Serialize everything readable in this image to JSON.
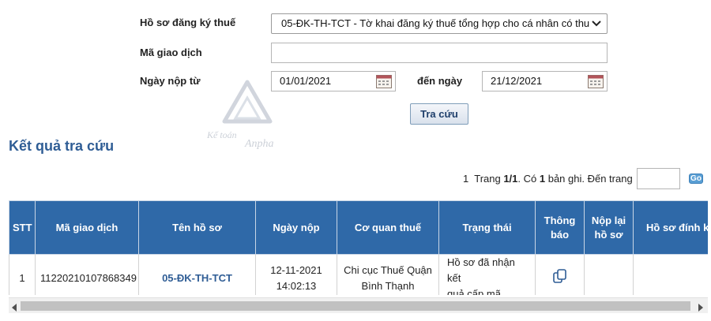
{
  "form": {
    "doc_type_label": "Hồ sơ đăng ký thuế",
    "doc_type_value": "05-ĐK-TH-TCT - Tờ khai đăng ký thuế tổng hợp cho cá nhân có thu",
    "transaction_code_label": "Mã giao dịch",
    "transaction_code_value": "",
    "date_from_label": "Ngày nộp từ",
    "date_from_value": "01/01/2021",
    "date_to_label": "đến ngày",
    "date_to_value": "21/12/2021",
    "search_button": "Tra cứu"
  },
  "watermark": {
    "text": "Kế toán Anpha"
  },
  "results": {
    "title": "Kết quả tra cứu",
    "paging": {
      "current": "1",
      "page_prefix": "Trang ",
      "page_info": "1/1",
      "count_prefix": ". Có ",
      "count": "1",
      "count_suffix": " bản ghi. Đến trang",
      "goto_value": "",
      "go_label": "Go"
    },
    "columns": {
      "stt": "STT",
      "code": "Mã giao dịch",
      "name": "Tên hồ sơ",
      "date": "Ngày nộp",
      "agency": "Cơ quan thuế",
      "status": "Trạng thái",
      "notice_1": "Thông",
      "notice_2": "báo",
      "resubmit_1": "Nộp lại",
      "resubmit_2": "hồ sơ",
      "attach": "Hồ sơ đính kèm"
    },
    "rows": [
      {
        "stt": "1",
        "code": "11220210107868349",
        "name": "05-ĐK-TH-TCT",
        "date": "12-11-2021",
        "time": "14:02:13",
        "agency_1": "Chi cục Thuế Quận",
        "agency_2": "Bình Thạnh",
        "status_1": "Hồ sơ đã nhận kết",
        "status_2": "quả cấp mã",
        "notice_icon": "copy-documents-icon"
      }
    ]
  },
  "colors": {
    "header_bg": "#2f69a8",
    "title_blue": "#2f5d95",
    "link_blue": "#2f5d95"
  }
}
